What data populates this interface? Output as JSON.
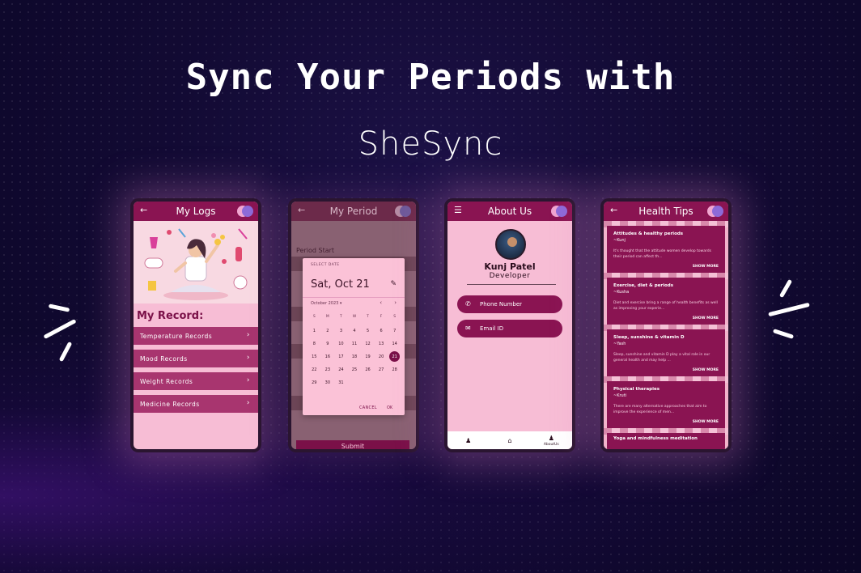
{
  "headline": "Sync Your Periods with",
  "brand": "SheSync",
  "phones": {
    "logs": {
      "title": "My Logs",
      "record_title": "My Record:",
      "rows": [
        "Temperature Records",
        "Mood Records",
        "Weight Records",
        "Medicine Records"
      ]
    },
    "period": {
      "title": "My Period",
      "period_start_label": "Period Start",
      "submit_label": "Submit",
      "picker": {
        "header": "SELECT DATE",
        "selected_date": "Sat, Oct 21",
        "month_label": "October 2023 ▾",
        "weekdays": [
          "S",
          "M",
          "T",
          "W",
          "T",
          "F",
          "S"
        ],
        "weeks": [
          [
            "1",
            "2",
            "3",
            "4",
            "5",
            "6",
            "7"
          ],
          [
            "8",
            "9",
            "10",
            "11",
            "12",
            "13",
            "14"
          ],
          [
            "15",
            "16",
            "17",
            "18",
            "19",
            "20",
            "21"
          ],
          [
            "22",
            "23",
            "24",
            "25",
            "26",
            "27",
            "28"
          ],
          [
            "29",
            "30",
            "31",
            "",
            "",
            "",
            ""
          ]
        ],
        "selected_day": "21",
        "cancel_label": "CANCEL",
        "ok_label": "OK"
      }
    },
    "about": {
      "title": "About Us",
      "name": "Kunj Patel",
      "role": "Developer",
      "phone_label": "Phone Number",
      "email_label": "Email ID",
      "nav_about_label": "AboutUs"
    },
    "tips": {
      "title": "Health Tips",
      "cards": [
        {
          "title": "Attitudes & healthy periods",
          "author": "~Kunj",
          "body": "It's thought that the attitude women develop towards their period can affect th...",
          "more": "SHOW MORE"
        },
        {
          "title": "Exercise, diet & periods",
          "author": "~Kusha",
          "body": "Diet and exercise bring a range of health benefits as well as improving your experie...",
          "more": "SHOW MORE"
        },
        {
          "title": "Sleep, sunshine & vitamin D",
          "author": "~Yash",
          "body": "Sleep, sunshine and vitamin D play a vital role in our general health and may help ...",
          "more": "SHOW MORE"
        },
        {
          "title": "Physical therapies",
          "author": "~Kruti",
          "body": "There are many alternative approaches that aim to improve the experience of men...",
          "more": "SHOW MORE"
        }
      ],
      "partial_title": "Yoga and mindfulness meditation"
    }
  },
  "colors": {
    "background": "#120a33",
    "app_primary": "#8a1452",
    "app_surface": "#f7bdd5"
  }
}
